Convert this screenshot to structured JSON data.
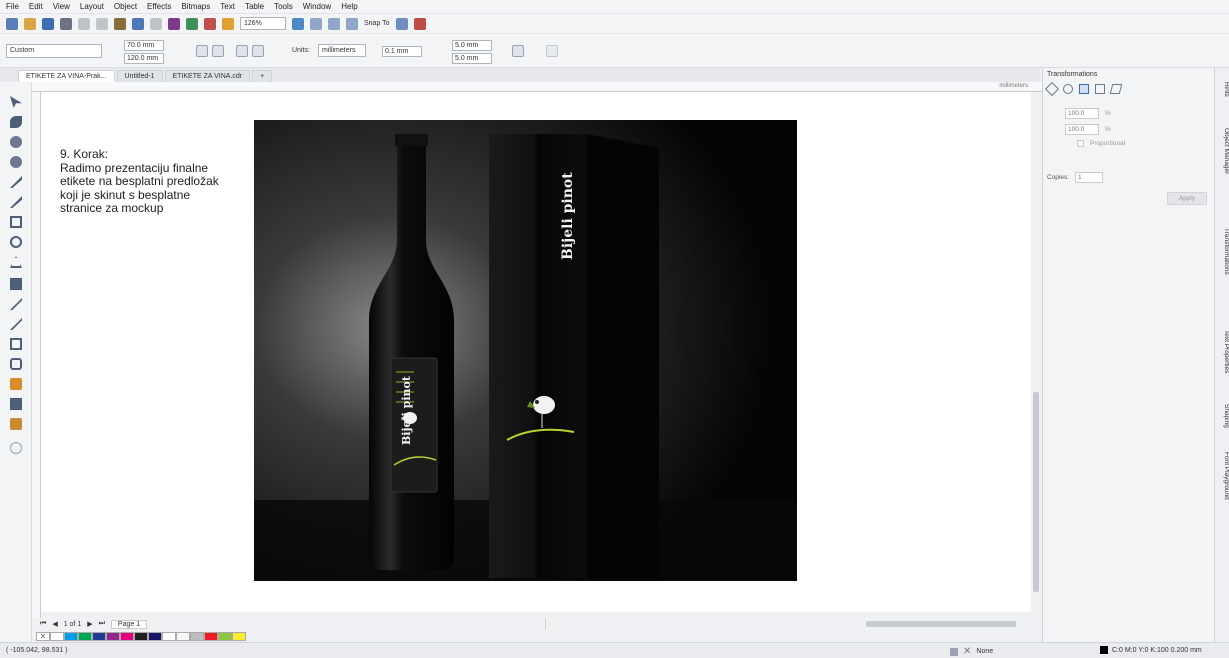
{
  "menu": [
    "File",
    "Edit",
    "View",
    "Layout",
    "Object",
    "Effects",
    "Bitmaps",
    "Text",
    "Table",
    "Tools",
    "Window",
    "Help"
  ],
  "toolbar": {
    "zoom_value": "126%",
    "snap_label": "Snap To"
  },
  "propbar": {
    "preset": "Custom",
    "width": "70.0 mm",
    "height": "120.0 mm",
    "units_label": "Units:",
    "units_value": "millimeters",
    "nudge": "0.1 mm",
    "dup_x": "5.0 mm",
    "dup_y": "5.0 mm"
  },
  "tabs": [
    "ETIKETE ZA VINA-Prak...",
    "Untitled-1",
    "ETIKETE ZA VINA.cdr"
  ],
  "ruler_unit": "millimeters",
  "caption": "9. Korak:\nRadimo prezentaciju finalne\netikete na besplatni predložak\nkoji je skinut s besplatne\nstranice za mockup",
  "mockup": {
    "bottle_label": "Bijeli pinot",
    "box_label": "Bijeli pinot"
  },
  "pagenav": {
    "pages": "1 of 1",
    "page_tab": "Page 1"
  },
  "palette": [
    "#ffffff",
    "#00a0e9",
    "#00a651",
    "#1e3d8f",
    "#92278f",
    "#e4007f",
    "#231f20",
    "#1b1464",
    "#ffffff",
    "#f7f7f7",
    "#bcbec0",
    "#ed1c24",
    "#8dc63f",
    "#f9ed32"
  ],
  "status": {
    "coords": "( -105.042, 98.531 )",
    "fill": "None",
    "outline": "C:0 M:0 Y:0 K:100  0.200 mm"
  },
  "dock": {
    "title": "Transformations",
    "h_value": "100.0",
    "v_value": "100.0",
    "unit": "%",
    "proportional": "Proportional",
    "copies_label": "Copies:",
    "copies_value": "1",
    "apply": "Apply"
  },
  "side_tabs": [
    "Hints",
    "Object Manager",
    "Transformations",
    "Text Properties",
    "Shaping",
    "Font Playground"
  ]
}
